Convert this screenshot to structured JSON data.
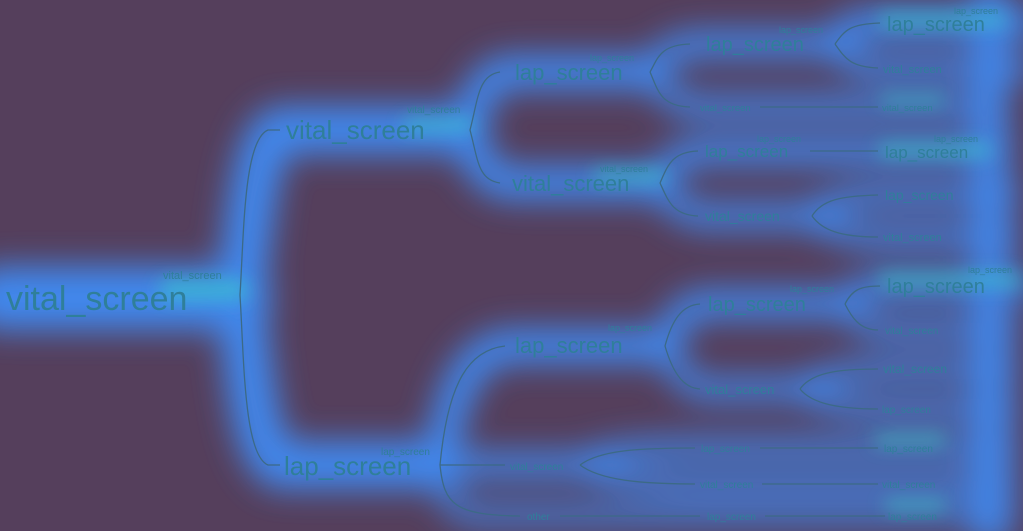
{
  "colors": {
    "background": "#553f5c",
    "glow": "#3f8cf6",
    "glow_hot": "#37d2c8",
    "text": "#2f7f9a",
    "edge": "#3c6a86"
  },
  "tree": {
    "root": "vital_screen",
    "root_edge": "vital_screen",
    "l1": {
      "upper": {
        "label": "vital_screen",
        "edge": "vital_screen",
        "children": {
          "a": {
            "label": "lap_screen",
            "edge": "lap_screen",
            "children": {
              "a1": {
                "label": "lap_screen",
                "edge": "lap_screen",
                "leaf_top": "lap_screen",
                "leaf_top_edge": "lap_screen",
                "leaf_bottom": "vital_screen"
              },
              "a2": {
                "label": "vital_screen",
                "leaf": "vital_screen"
              }
            }
          },
          "b": {
            "label": "vital_screen",
            "edge": "vital_screen",
            "children": {
              "b1": {
                "label": "lap_screen",
                "edge": "lap_screen",
                "leaf": "lap_screen",
                "leaf_edge": "lap_screen"
              },
              "b2": {
                "label": "vital_screen",
                "leaf_top": "lap_screen",
                "leaf_bottom": "vital_screen"
              }
            }
          }
        }
      },
      "lower": {
        "label": "lap_screen",
        "edge": "lap_screen",
        "children": {
          "c": {
            "label": "lap_screen",
            "edge": "lap_screen",
            "children": {
              "c1": {
                "label": "lap_screen",
                "edge": "lap_screen",
                "leaf_top": "lap_screen",
                "leaf_top_edge": "lap_screen",
                "leaf_bottom": "vital_screen"
              },
              "c2": {
                "label": "vital_screen",
                "leaf_top": "vital_screen",
                "leaf_bottom": "lap_screen"
              }
            }
          },
          "d": {
            "label": "vital_screen",
            "children": {
              "d1": {
                "label": "lap_screen",
                "leaf": "lap_screen"
              },
              "d2": {
                "label": "vital_screen",
                "leaf": "vital_screen"
              }
            }
          },
          "e": {
            "label": "other",
            "children": {
              "e1": {
                "label": "lap_screen",
                "leaf": "lap_screen"
              }
            }
          }
        }
      }
    }
  }
}
